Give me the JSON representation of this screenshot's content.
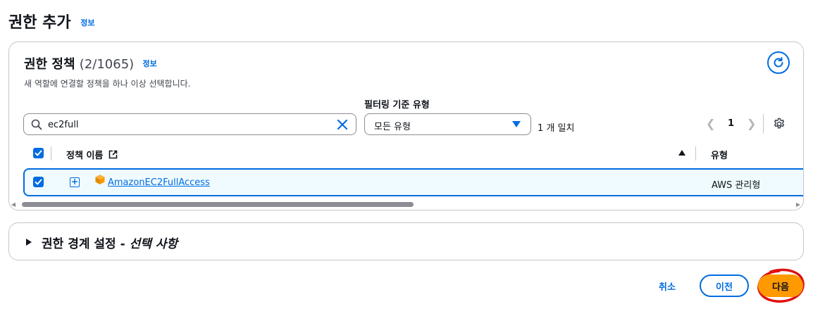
{
  "page": {
    "title": "권한 추가",
    "info": "정보"
  },
  "policies": {
    "title": "권한 정책",
    "count": "(2/1065)",
    "info": "정보",
    "description": "새 역할에 연결할 정책을 하나 이상 선택합니다.",
    "filter_label": "필터링 기준 유형",
    "search_value": "ec2full",
    "filter_selected": "모든 유형",
    "match_count": "1 개 일치",
    "current_page": "1",
    "columns": {
      "name": "정책 이름",
      "type": "유형"
    },
    "rows": [
      {
        "name": "AmazonEC2FullAccess",
        "type": "AWS 관리형",
        "selected": true
      }
    ]
  },
  "boundary": {
    "title": "권한 경계 설정 - ",
    "title_optional": "선택 사항"
  },
  "footer": {
    "cancel": "취소",
    "previous": "이전",
    "next": "다음"
  },
  "colors": {
    "accent": "#006ce0",
    "primary_button": "#ff9900",
    "annotation": "#e01010"
  }
}
